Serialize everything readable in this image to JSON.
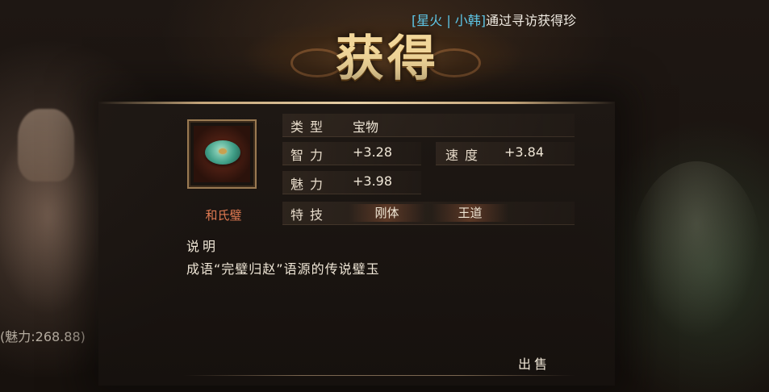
{
  "ticker": {
    "tag": "[星火 | 小韩]",
    "message": "通过寻访获得珍"
  },
  "title": "获得",
  "item": {
    "name": "和氏璧",
    "icon": "jade-disc-icon"
  },
  "stats": {
    "type_label": "类型",
    "type_value": "宝物",
    "intel_label": "智力",
    "intel_value": "+3.28",
    "speed_label": "速度",
    "speed_value": "+3.84",
    "charm_label": "魅力",
    "charm_value": "+3.98",
    "skill_label": "特技",
    "skills": [
      "刚体",
      "王道"
    ]
  },
  "description": {
    "label": "说明",
    "text": "成语“完璧归赵”语源的传说璧玉"
  },
  "sell_label": "出售",
  "background": {
    "left_text": "(魅力:268.88)"
  },
  "colors": {
    "title": "#f2d79a",
    "item_name": "#e07a52",
    "ticker_tag": "#5ec7e8"
  }
}
